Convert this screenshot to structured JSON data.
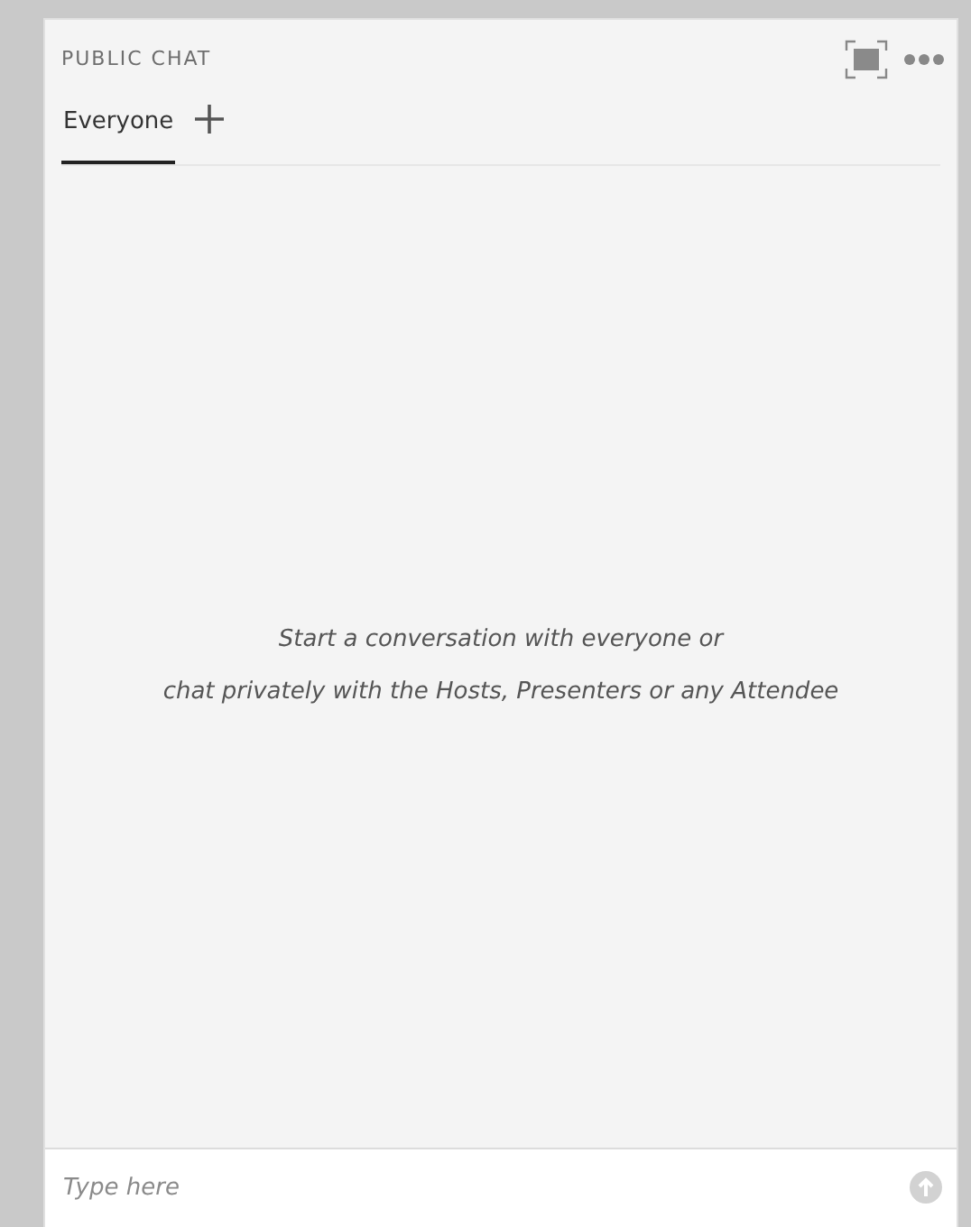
{
  "panel": {
    "title": "PUBLIC CHAT"
  },
  "tabs": [
    {
      "label": "Everyone",
      "selected": true
    }
  ],
  "empty_message": [
    "Start a conversation with everyone or",
    "chat privately with the Hosts, Presenters or any Attendee"
  ],
  "composer": {
    "placeholder": "Type here"
  }
}
